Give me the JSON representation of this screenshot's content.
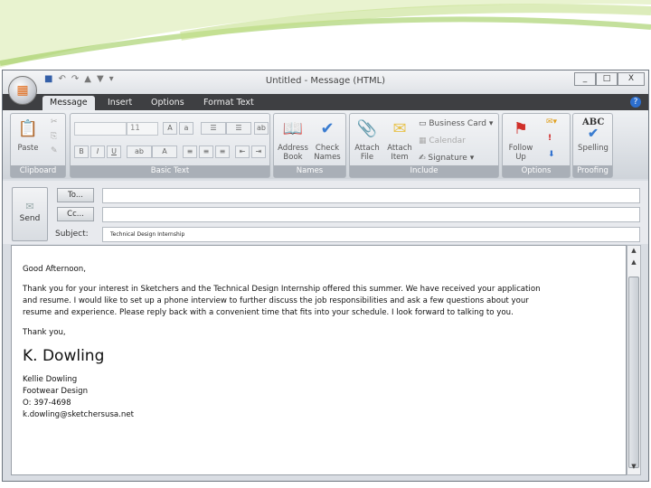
{
  "window": {
    "title": "Untitled - Message (HTML)",
    "controls": [
      "_",
      "□",
      "X"
    ]
  },
  "tabs": [
    "Message",
    "Insert",
    "Options",
    "Format Text"
  ],
  "ribbon": {
    "clipboard": {
      "label": "Clipboard",
      "paste": "Paste"
    },
    "basic_text": {
      "label": "Basic Text",
      "font_size": "11",
      "bold": "B",
      "italic": "I",
      "underline": "U"
    },
    "names": {
      "label": "Names",
      "address_book": "Address Book",
      "check_names": "Check Names"
    },
    "include": {
      "label": "Include",
      "attach_file": "Attach File",
      "attach_item": "Attach Item",
      "business_card": "Business Card",
      "calendar": "Calendar",
      "signature": "Signature"
    },
    "options": {
      "label": "Options",
      "follow_up": "Follow Up"
    },
    "proofing": {
      "label": "Proofing",
      "spelling": "Spelling",
      "abc": "ABC"
    }
  },
  "header": {
    "send": "Send",
    "to": "To...",
    "cc": "Cc...",
    "subject_label": "Subject:",
    "to_value": "",
    "cc_value": "",
    "subject_value": "Technical Design Internship"
  },
  "body": {
    "greeting": "Good Afternoon,",
    "paragraph": "Thank you for your interest in Sketchers and the Technical Design Internship offered this summer. We have received your application and resume. I would like to set up a phone interview to further discuss the job responsibilities and ask a few questions about your resume and experience. Please reply back with a convenient time that fits into your schedule.  I look forward to talking to you.",
    "closing": "Thank you,",
    "signature_script": "K. Dowling",
    "name": "Kellie Dowling",
    "department": "Footwear Design",
    "phone": "O: 397-4698",
    "email": "k.dowling@sketchersusa.net"
  }
}
